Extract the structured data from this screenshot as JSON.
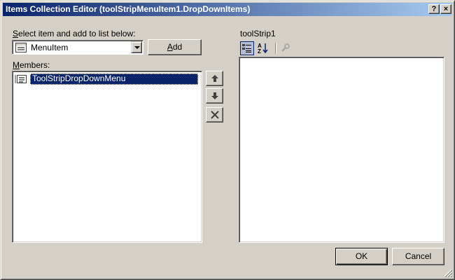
{
  "window": {
    "title": "Items Collection Editor (toolStripMenuItem1.DropDownItems)",
    "help_button": "?",
    "close_button": "×"
  },
  "left": {
    "select_label_accel": "S",
    "select_label_rest": "elect item and add to list below:",
    "combo": {
      "icon": "menu-item-icon",
      "value": "MenuItem"
    },
    "add_button": {
      "accel": "A",
      "rest": "dd"
    },
    "members_label_accel": "M",
    "members_label_rest": "embers:",
    "members": [
      {
        "icon": "dropdown-menu-icon",
        "label": "ToolStripDropDownMenu",
        "selected": true
      }
    ],
    "side_buttons": [
      "move-up-icon",
      "move-down-icon",
      "delete-icon"
    ]
  },
  "right": {
    "properties_title": "toolStrip1",
    "toolbar": [
      "categorized-icon",
      "alphabetical-icon",
      "property-pages-icon"
    ]
  },
  "footer": {
    "ok_label": "OK",
    "cancel_label": "Cancel"
  },
  "colors": {
    "title_gradient_start": "#0a246a",
    "title_gradient_end": "#a6caf0",
    "face": "#d4d0c8",
    "selection": "#0a246a"
  }
}
